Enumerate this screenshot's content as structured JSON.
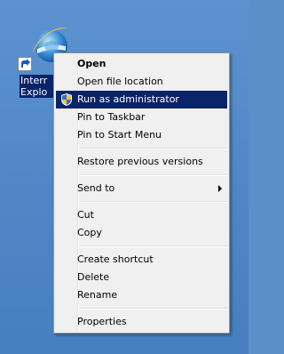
{
  "desktop": {
    "icon_label": "Internet\nExplorer",
    "icon_visible_label": "Interr\nExplo"
  },
  "menu": {
    "items": [
      {
        "label": "Open",
        "bold": true
      },
      {
        "label": "Open file location"
      },
      {
        "label": "Run as administrator",
        "highlighted": true,
        "icon": "uac-shield-icon"
      },
      {
        "label": "Pin to Taskbar"
      },
      {
        "label": "Pin to Start Menu"
      },
      {
        "label": "Restore previous versions"
      },
      {
        "label": "Send to",
        "submenu": true
      },
      {
        "label": "Cut"
      },
      {
        "label": "Copy"
      },
      {
        "label": "Create shortcut"
      },
      {
        "label": "Delete"
      },
      {
        "label": "Rename"
      },
      {
        "label": "Properties"
      }
    ]
  },
  "colors": {
    "desktop_bg": "#5a8fca",
    "highlight": "#0a246a",
    "menu_bg": "#f0f0f0"
  }
}
